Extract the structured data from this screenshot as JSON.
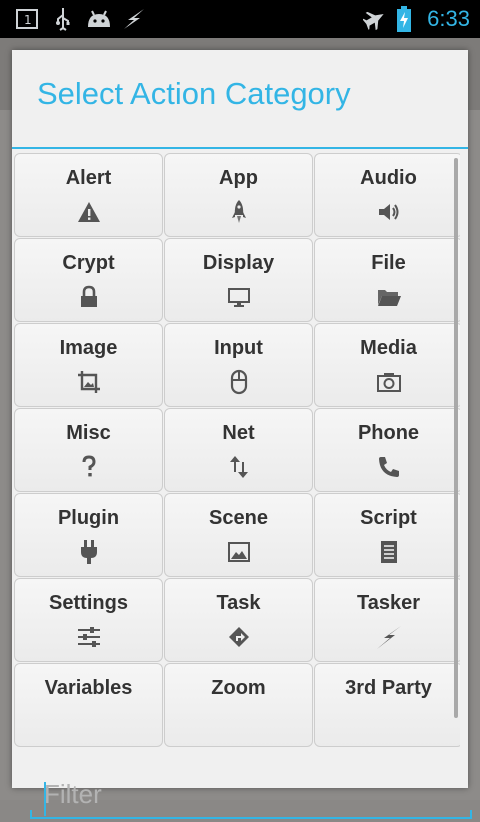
{
  "status_bar": {
    "time": "6:33",
    "icons": [
      "sim-card-icon",
      "usb-icon",
      "android-debug-icon",
      "flash-icon",
      "airplane-mode-icon",
      "battery-charging-icon"
    ]
  },
  "dialog": {
    "title": "Select Action Category",
    "categories": [
      {
        "label": "Alert",
        "icon": "warning-icon"
      },
      {
        "label": "App",
        "icon": "rocket-icon"
      },
      {
        "label": "Audio",
        "icon": "speaker-icon"
      },
      {
        "label": "Crypt",
        "icon": "lock-icon"
      },
      {
        "label": "Display",
        "icon": "monitor-icon"
      },
      {
        "label": "File",
        "icon": "folder-open-icon"
      },
      {
        "label": "Image",
        "icon": "crop-icon"
      },
      {
        "label": "Input",
        "icon": "mouse-icon"
      },
      {
        "label": "Media",
        "icon": "camera-icon"
      },
      {
        "label": "Misc",
        "icon": "question-icon"
      },
      {
        "label": "Net",
        "icon": "up-down-arrows-icon"
      },
      {
        "label": "Phone",
        "icon": "phone-icon"
      },
      {
        "label": "Plugin",
        "icon": "plug-icon"
      },
      {
        "label": "Scene",
        "icon": "picture-icon"
      },
      {
        "label": "Script",
        "icon": "document-icon"
      },
      {
        "label": "Settings",
        "icon": "sliders-icon"
      },
      {
        "label": "Task",
        "icon": "diamond-arrow-icon"
      },
      {
        "label": "Tasker",
        "icon": "lightning-icon"
      },
      {
        "label": "Variables",
        "icon": ""
      },
      {
        "label": "Zoom",
        "icon": ""
      },
      {
        "label": "3rd Party",
        "icon": ""
      }
    ],
    "filter": {
      "placeholder": "Filter",
      "value": ""
    }
  },
  "colors": {
    "accent": "#33b5e5",
    "dialog_bg": "#f0f0f0",
    "status_bar_bg": "#000000"
  }
}
